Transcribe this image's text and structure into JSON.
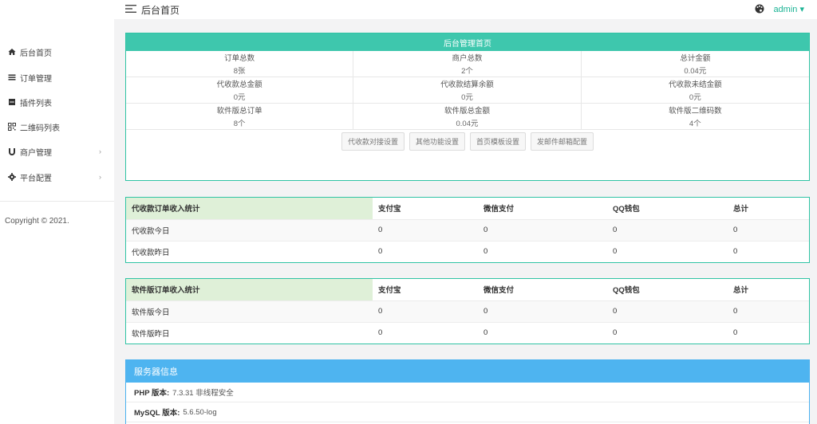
{
  "topbar": {
    "title": "后台首页",
    "user": "admin",
    "user_caret": "▾"
  },
  "sidebar": {
    "items": [
      {
        "label": "后台首页",
        "icon": "home-icon",
        "caret": ""
      },
      {
        "label": "订单管理",
        "icon": "list-icon",
        "caret": ""
      },
      {
        "label": "插件列表",
        "icon": "plugin-icon",
        "caret": ""
      },
      {
        "label": "二维码列表",
        "icon": "qrcode-icon",
        "caret": ""
      },
      {
        "label": "商户管理",
        "icon": "magnet-icon",
        "caret": "›"
      },
      {
        "label": "平台配置",
        "icon": "gear-icon",
        "caret": "›"
      }
    ],
    "copyright": "Copyright © 2021."
  },
  "overview": {
    "title": "后台管理首页",
    "stats": [
      {
        "label": "订单总数",
        "value": "8张"
      },
      {
        "label": "商户总数",
        "value": "2个"
      },
      {
        "label": "总计金额",
        "value": "0.04元"
      },
      {
        "label": "代收款总金额",
        "value": "0元"
      },
      {
        "label": "代收款结算余额",
        "value": "0元"
      },
      {
        "label": "代收款未结金额",
        "value": "0元"
      },
      {
        "label": "软件版总订单",
        "value": "8个"
      },
      {
        "label": "软件版总金额",
        "value": "0.04元"
      },
      {
        "label": "软件版二维码数",
        "value": "4个"
      }
    ],
    "buttons": [
      "代收款对接设置",
      "其他功能设置",
      "首页模板设置",
      "发邮件邮箱配置"
    ]
  },
  "table1": {
    "headers": [
      "代收款订单收入统计",
      "支付宝",
      "微信支付",
      "QQ钱包",
      "总计"
    ],
    "rows": [
      [
        "代收款今日",
        "0",
        "0",
        "0",
        "0"
      ],
      [
        "代收款昨日",
        "0",
        "0",
        "0",
        "0"
      ]
    ]
  },
  "table2": {
    "headers": [
      "软件版订单收入统计",
      "支付宝",
      "微信支付",
      "QQ钱包",
      "总计"
    ],
    "rows": [
      [
        "软件版今日",
        "0",
        "0",
        "0",
        "0"
      ],
      [
        "软件版昨日",
        "0",
        "0",
        "0",
        "0"
      ]
    ]
  },
  "server": {
    "title": "服务器信息",
    "rows": [
      {
        "label": "PHP 版本:",
        "value": "7.3.31 非线程安全"
      },
      {
        "label": "MySQL 版本:",
        "value": "5.6.50-log"
      }
    ]
  },
  "colors": {
    "accent": "#3ec7ad",
    "info": "#4eb4f0",
    "link": "#1ab394"
  }
}
